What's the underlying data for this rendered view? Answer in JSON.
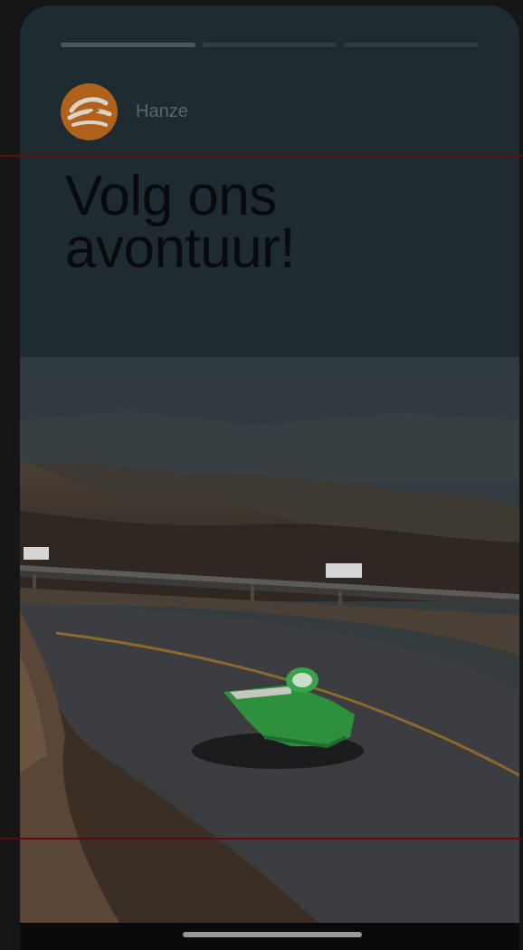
{
  "story": {
    "segments": [
      {
        "state": "active"
      },
      {
        "state": "inactive"
      },
      {
        "state": "inactive"
      }
    ],
    "profile": {
      "name": "Hanze",
      "logo_icon": "hanze-logo-icon"
    },
    "headline_line1": "Volg ons",
    "headline_line2": "avontuur!",
    "image": {
      "icon": "solar-car-photo"
    }
  },
  "colors": {
    "background": "#161616",
    "story_bg": "#1e2b31",
    "logo_orange": "#b0621a",
    "car_green": "#2e8f3c",
    "guide_red": "#5a0e10"
  }
}
